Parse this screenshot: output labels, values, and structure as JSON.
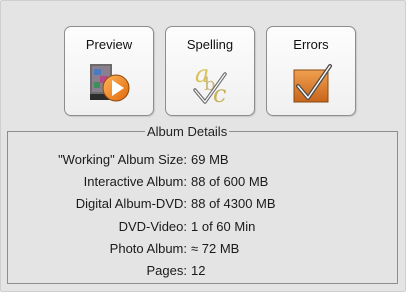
{
  "toolbar": {
    "buttons": [
      {
        "label": "Preview",
        "icon": "preview-play-icon"
      },
      {
        "label": "Spelling",
        "icon": "spelling-check-icon"
      },
      {
        "label": "Errors",
        "icon": "errors-check-icon"
      }
    ]
  },
  "details": {
    "title": "Album Details",
    "rows": [
      {
        "label": "\"Working\" Album Size:",
        "value": "69 MB"
      },
      {
        "label": "Interactive Album:",
        "value": "88 of 600 MB"
      },
      {
        "label": "Digital Album-DVD:",
        "value": "88 of 4300 MB"
      },
      {
        "label": "DVD-Video:",
        "value": "1 of 60 Min"
      },
      {
        "label": "Photo Album:",
        "value": "≈ 72 MB"
      },
      {
        "label": "Pages:",
        "value": "12"
      }
    ]
  },
  "colors": {
    "panel_bg": "#e4e4e4",
    "border": "#8d8d8d",
    "check_orange": "#d77a2a",
    "play_orange": "#f08a1c"
  }
}
